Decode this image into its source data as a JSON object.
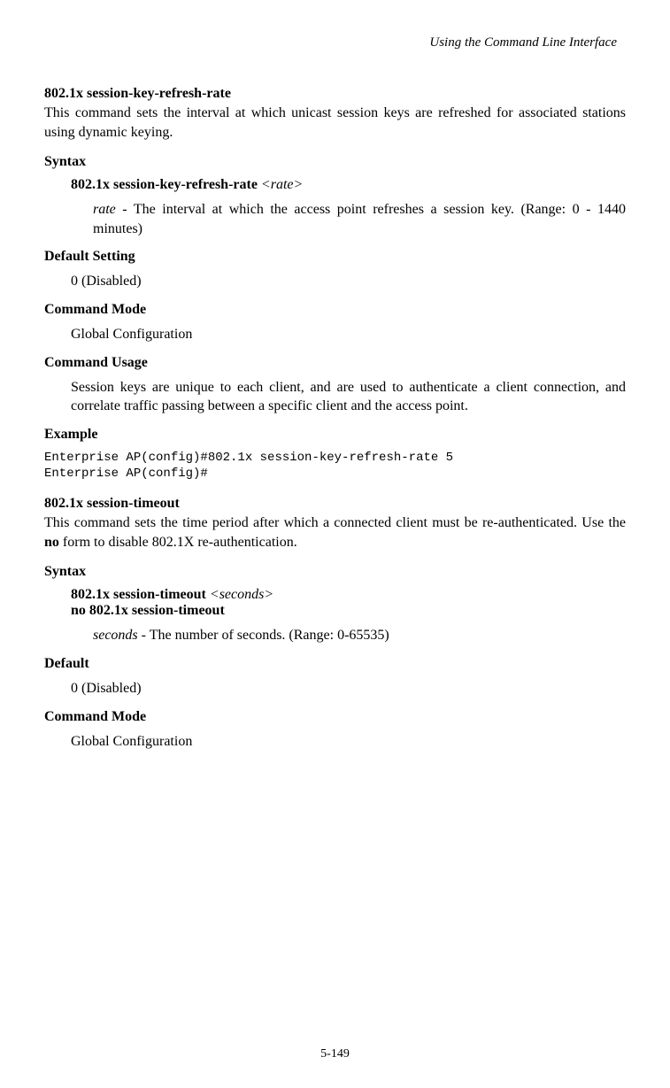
{
  "header": {
    "title": "Using the Command Line Interface"
  },
  "section1": {
    "commandTitle": "802.1x session-key-refresh-rate",
    "description": "This command sets the interval at which unicast session keys are refreshed for associated stations using dynamic keying.",
    "syntaxLabel": "Syntax",
    "syntaxCommand": "802.1x session-key-refresh-rate",
    "syntaxParam": "<rate>",
    "paramName": "rate",
    "paramDesc": " - The interval at which the access point refreshes a session key. (Range: 0 - 1440 minutes)",
    "defaultLabel": "Default Setting",
    "defaultValue": "0 (Disabled)",
    "commandModeLabel": "Command Mode",
    "commandModeValue": "Global Configuration",
    "usageLabel": "Command Usage",
    "usageText": "Session keys are unique to each client, and are used to authenticate a client connection, and correlate traffic passing between a specific client and the access point.",
    "exampleLabel": "Example",
    "exampleCode": "Enterprise AP(config)#802.1x session-key-refresh-rate 5\nEnterprise AP(config)#"
  },
  "section2": {
    "commandTitle": "802.1x session-timeout",
    "descriptionPart1": "This command sets the time period after which a connected client must be re-authenticated. Use the ",
    "descriptionBold": "no",
    "descriptionPart2": " form to disable 802.1X re-authentication.",
    "syntaxLabel": "Syntax",
    "syntaxCommand": "802.1x session-timeout",
    "syntaxParam": "<seconds>",
    "syntaxNo": "no 802.1x session-timeout",
    "paramName": "seconds",
    "paramDesc": " - The number of seconds. (Range: 0-65535)",
    "defaultLabel": "Default",
    "defaultValue": "0 (Disabled)",
    "commandModeLabel": "Command Mode",
    "commandModeValue": "Global Configuration"
  },
  "footer": {
    "pageNumber": "5-149"
  }
}
